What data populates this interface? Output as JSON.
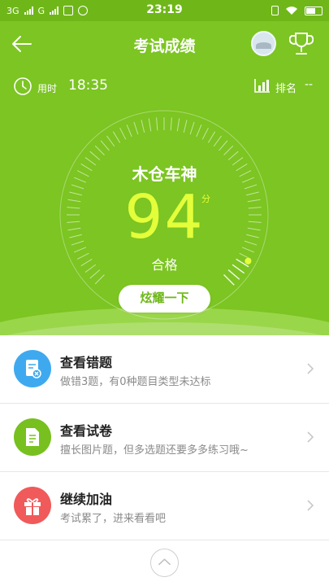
{
  "status_bar": {
    "network1": "3G",
    "network2": "G",
    "time": "23:19"
  },
  "header": {
    "title": "考试成绩"
  },
  "stats": {
    "time_label": "用时",
    "time_value": "18:35",
    "rank_label": "排名",
    "rank_value": "--"
  },
  "result": {
    "nickname": "木仓车神",
    "score": "94",
    "score_unit": "分",
    "score_fraction": 0.94,
    "status": "合格",
    "share_button": "炫耀一下"
  },
  "menu": [
    {
      "title": "查看错题",
      "subtitle": "做错3题，有0种题目类型未达标",
      "icon": "wrong-question-icon",
      "color": "#3fa9f0"
    },
    {
      "title": "查看试卷",
      "subtitle": "擅长图片题，但多选题还要多多练习哦~",
      "icon": "paper-icon",
      "color": "#78c01f"
    },
    {
      "title": "继续加油",
      "subtitle": "考试累了，进来看看吧",
      "icon": "gift-icon",
      "color": "#f05a5a"
    }
  ],
  "colors": {
    "primary": "#7cc522",
    "score": "#e4ff3a"
  }
}
